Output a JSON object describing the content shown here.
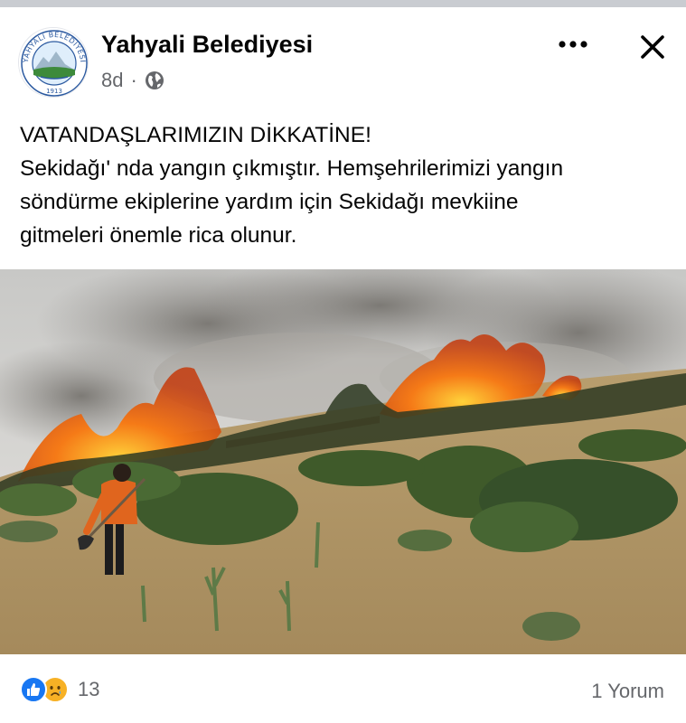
{
  "post": {
    "author": "Yahyali Belediyesi",
    "time": "8d",
    "separator": "·",
    "privacy_icon": "globe-icon",
    "avatar_logo": {
      "text_top": "YAHYALI BELEDİYESİ",
      "year": "1913"
    },
    "text_lines": [
      "VATANDAŞLARIMIZIN DİKKATİNE!",
      "Sekidağı' nda yangın çıkmıştır. Hemşehrilerimizi yangın",
      "söndürme ekiplerine yardım için Sekidağı mevkiine",
      "gitmeleri önemle rica olunur."
    ],
    "image_icon": "wildfire-photo",
    "reactions": {
      "icons": [
        "like-icon",
        "sad-icon"
      ],
      "count": "13"
    },
    "comments": "1 Yorum"
  },
  "colors": {
    "like": "#1877f2",
    "sad": "#f7b125",
    "secondary_text": "#65676b",
    "primary_text": "#050505"
  }
}
